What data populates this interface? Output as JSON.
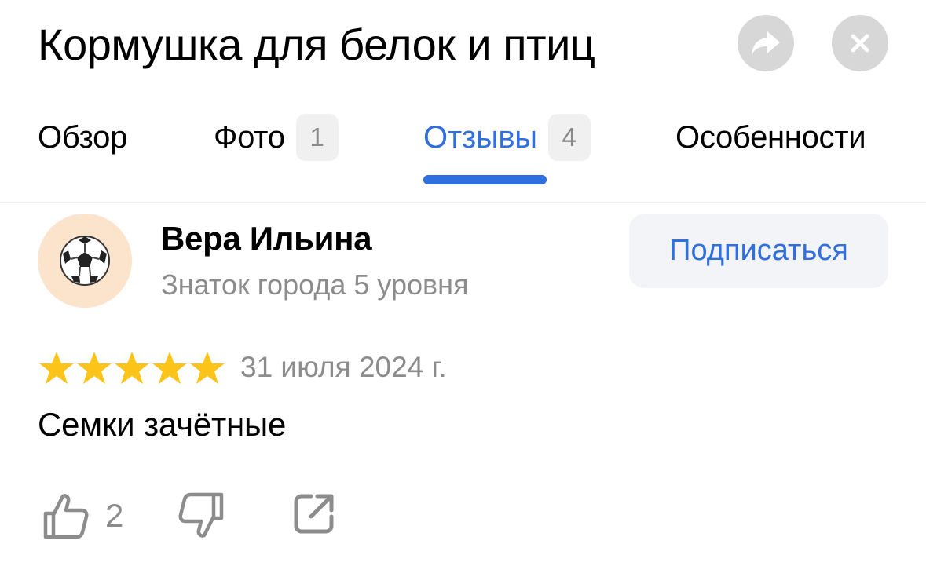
{
  "header": {
    "title": "Кормушка для белок и птиц",
    "share_icon": "share-arrow-icon",
    "close_icon": "close-icon"
  },
  "tabs": [
    {
      "label": "Обзор",
      "count": null,
      "active": false
    },
    {
      "label": "Фото",
      "count": "1",
      "active": false
    },
    {
      "label": "Отзывы",
      "count": "4",
      "active": true
    },
    {
      "label": "Особенности",
      "count": null,
      "active": false
    }
  ],
  "review": {
    "author": {
      "name": "Вера Ильина",
      "level": "Знаток города 5 уровня",
      "avatar_icon": "soccer-ball-icon"
    },
    "subscribe_label": "Подписаться",
    "rating": 5,
    "rating_max": 5,
    "date": "31 июля 2024 г.",
    "text": "Семки зачётные",
    "likes": "2",
    "actions": [
      "like-icon",
      "dislike-icon",
      "share-icon"
    ]
  },
  "colors": {
    "accent": "#2f6fe0",
    "star": "#fcc419",
    "muted_text": "#8c8c8c",
    "avatar_bg": "#fbe3cc",
    "round_button": "#d7d7d7"
  }
}
